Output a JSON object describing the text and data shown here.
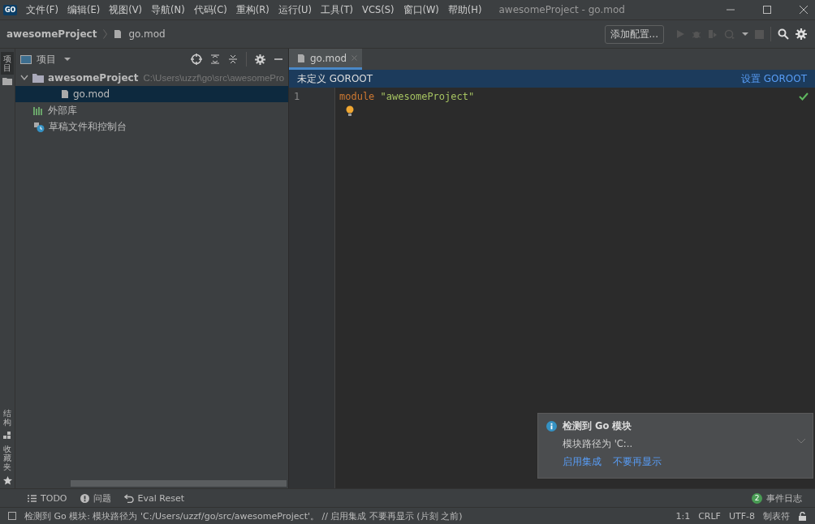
{
  "window": {
    "title": "awesomeProject - go.mod",
    "app_icon": "GO"
  },
  "menu": [
    "文件(F)",
    "编辑(E)",
    "视图(V)",
    "导航(N)",
    "代码(C)",
    "重构(R)",
    "运行(U)",
    "工具(T)",
    "VCS(S)",
    "窗口(W)",
    "帮助(H)"
  ],
  "breadcrumbs": [
    {
      "label": "awesomeProject",
      "kind": "project"
    },
    {
      "label": "go.mod",
      "kind": "file"
    }
  ],
  "toolbar": {
    "config_button": "添加配置..."
  },
  "left_strip": {
    "top": [
      {
        "label": "项目",
        "selected": true
      }
    ],
    "bottom": [
      {
        "label": "结构",
        "kind": "structure"
      },
      {
        "label": "收藏夹",
        "kind": "favorites"
      }
    ]
  },
  "project_panel": {
    "title": "项目",
    "tree": [
      {
        "label": "awesomeProject",
        "path": "C:\\Users\\uzzf\\go\\src\\awesomePro",
        "kind": "folder",
        "expanded": true,
        "selected": false,
        "children": [
          {
            "label": "go.mod",
            "kind": "file",
            "selected": true
          }
        ]
      },
      {
        "label": "外部库",
        "kind": "library",
        "selected": false
      },
      {
        "label": "草稿文件和控制台",
        "kind": "scratch",
        "selected": false
      }
    ]
  },
  "editor": {
    "tabs": [
      {
        "label": "go.mod",
        "selected": true
      }
    ],
    "banner": {
      "text": "未定义 GOROOT",
      "action": "设置 GOROOT"
    },
    "lines": [
      {
        "number": "1",
        "keyword": "module",
        "string": "\"awesomeProject\""
      }
    ]
  },
  "notification": {
    "title": "检测到 Go 模块",
    "body": "模块路径为 'C:..",
    "actions": [
      "启用集成",
      "不要再显示"
    ]
  },
  "tool_windows": [
    {
      "label": "TODO",
      "kind": "todo"
    },
    {
      "label": "问题",
      "kind": "problems"
    },
    {
      "label": "Eval Reset",
      "kind": "reset"
    }
  ],
  "event_log": {
    "count": "2",
    "label": "事件日志"
  },
  "status_bar": {
    "message": "检测到 Go 模块: 模块路径为 'C:/Users/uzzf/go/src/awesomeProject'。 // 启用集成   不要再显示 (片刻 之前)",
    "position": "1:1",
    "line_ending": "CRLF",
    "encoding": "UTF-8",
    "indent": "制表符"
  }
}
